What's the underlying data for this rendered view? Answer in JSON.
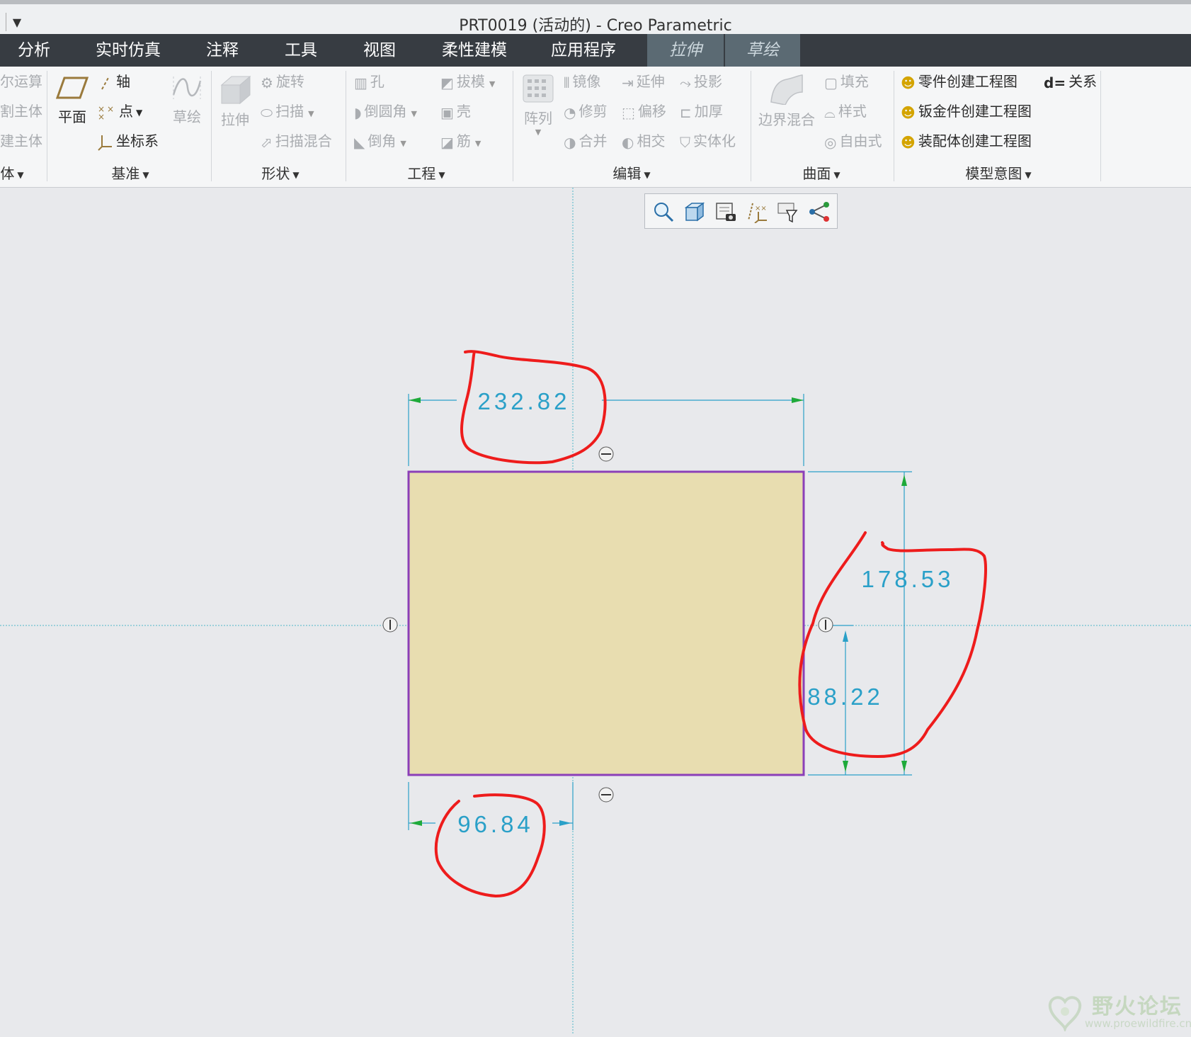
{
  "window": {
    "title": "PRT0019 (活动的) - Creo Parametric",
    "quick_access_menu": "▼"
  },
  "menu_tabs": [
    {
      "label": "分析"
    },
    {
      "label": "实时仿真"
    },
    {
      "label": "注释"
    },
    {
      "label": "工具"
    },
    {
      "label": "视图"
    },
    {
      "label": "柔性建模"
    },
    {
      "label": "应用程序"
    },
    {
      "label": "拉伸"
    },
    {
      "label": "草绘"
    }
  ],
  "ribbon": {
    "groups": [
      {
        "label": "体",
        "items": [
          "尔运算",
          "割主体",
          "建主体"
        ]
      },
      {
        "label": "基准",
        "items": [
          "平面",
          "轴",
          "点",
          "坐标系",
          "草绘"
        ]
      },
      {
        "label": "形状",
        "items": [
          "拉伸",
          "旋转",
          "扫描",
          "扫描混合"
        ]
      },
      {
        "label": "工程",
        "items": [
          "孔",
          "拔模",
          "倒圆角",
          "壳",
          "倒角",
          "筋"
        ]
      },
      {
        "label": "编辑",
        "items": [
          "阵列",
          "镜像",
          "延伸",
          "投影",
          "修剪",
          "偏移",
          "加厚",
          "合并",
          "相交",
          "实体化"
        ]
      },
      {
        "label": "曲面",
        "items": [
          "边界混合",
          "填充",
          "样式",
          "自由式"
        ]
      },
      {
        "label": "模型意图",
        "items": [
          "零件创建工程图",
          "钣金件创建工程图",
          "装配体创建工程图",
          "关系"
        ]
      }
    ],
    "relation_prefix": "d="
  },
  "sketch": {
    "dimensions": {
      "width_top": "232.82",
      "height_right": "178.53",
      "offset_vertical": "88.22",
      "offset_horizontal": "96.84"
    }
  },
  "watermark": {
    "title": "野火论坛",
    "url": "www.proewildfire.cn"
  },
  "colors": {
    "menubar": "#373c42",
    "context_tab": "#5b6a73",
    "sketch_fill": "#e8ddb0",
    "sketch_outline": "#8b3fb8",
    "dimension": "#2aa0c8",
    "annotation": "#ee1c1c"
  }
}
